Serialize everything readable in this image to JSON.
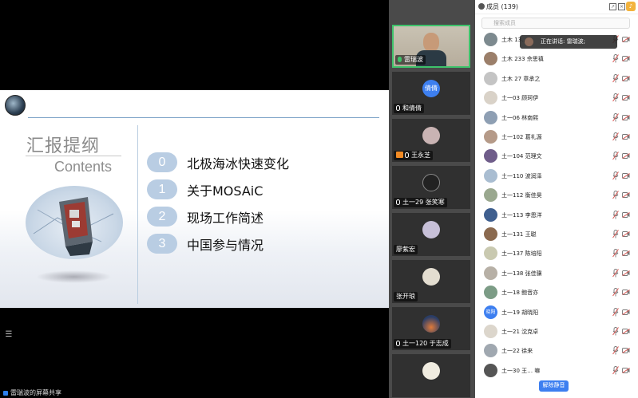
{
  "slide": {
    "title": "汇报提纲",
    "subtitle": "Contents",
    "agenda": [
      {
        "num": "0",
        "text": "北极海冰快速变化"
      },
      {
        "num": "1",
        "text": "关于MOSAiC"
      },
      {
        "num": "2",
        "text": "现场工作简述"
      },
      {
        "num": "3",
        "text": "中国参与情况"
      }
    ]
  },
  "share_footer": "雷瑞波的屏幕共享",
  "video_tiles": [
    {
      "name": "雷瑞波",
      "avatar_text": "",
      "mic": "green",
      "camera": false
    },
    {
      "name": "和倩倩",
      "avatar_text": "倩倩",
      "mic": "white",
      "camera": false
    },
    {
      "name": "王永芝",
      "avatar_text": "",
      "mic": "white",
      "camera": true
    },
    {
      "name": "土一29 张笑寒",
      "avatar_text": "",
      "mic": "white",
      "camera": false
    },
    {
      "name": "廖紫宏",
      "avatar_text": "",
      "mic": "none",
      "camera": false
    },
    {
      "name": "张开琅",
      "avatar_text": "",
      "mic": "none",
      "camera": false
    },
    {
      "name": "土一120 于志成",
      "avatar_text": "",
      "mic": "white",
      "camera": false
    },
    {
      "name": "",
      "avatar_text": "",
      "mic": "none",
      "camera": false
    }
  ],
  "members_panel": {
    "title": "成员 (139)",
    "search_placeholder": "搜索成员",
    "speaking_toast": "正在讲话: 雷瑞波;",
    "unmute_all_label": "解除静音",
    "members": [
      {
        "name": "土木 13…",
        "avatar_text": ""
      },
      {
        "name": "土木 233 佘思禛",
        "avatar_text": ""
      },
      {
        "name": "土木 27 章承之",
        "avatar_text": ""
      },
      {
        "name": "土一03 顾珂伊",
        "avatar_text": ""
      },
      {
        "name": "土一06 林南熙",
        "avatar_text": ""
      },
      {
        "name": "土一102 葛礼源",
        "avatar_text": ""
      },
      {
        "name": "土一104 范理文",
        "avatar_text": ""
      },
      {
        "name": "土一110 波润泽",
        "avatar_text": ""
      },
      {
        "name": "土一112 衡佳昊",
        "avatar_text": ""
      },
      {
        "name": "土一113 李恩洋",
        "avatar_text": ""
      },
      {
        "name": "土一131 王聪",
        "avatar_text": ""
      },
      {
        "name": "土一137 陈培阳",
        "avatar_text": ""
      },
      {
        "name": "土一138 张佳骥",
        "avatar_text": ""
      },
      {
        "name": "土一18 鲍音亦",
        "avatar_text": ""
      },
      {
        "name": "土一19 胡晓阳",
        "avatar_text": "晓阳"
      },
      {
        "name": "土一21 沈克卓",
        "avatar_text": ""
      },
      {
        "name": "土一22 徐来",
        "avatar_text": ""
      },
      {
        "name": "土一30 王… 嘛",
        "avatar_text": ""
      }
    ]
  },
  "colors": {
    "accent": "#3d7ff0",
    "active_border": "#3ec36b",
    "agenda_pill": "#b9cde3",
    "mic_muted": "#d9534f"
  }
}
